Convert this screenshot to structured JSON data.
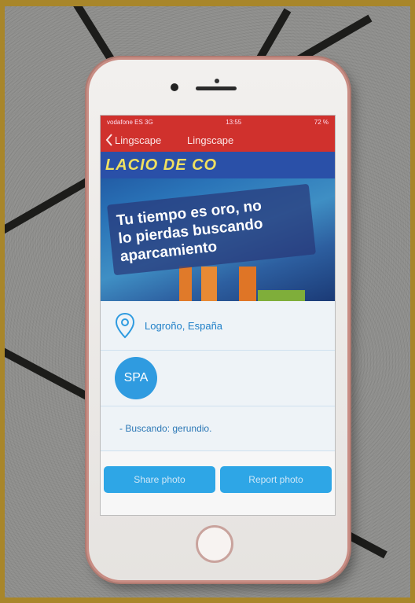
{
  "status_bar": {
    "carrier": "vodafone ES  3G",
    "time": "13:55",
    "battery": "72 %"
  },
  "navbar": {
    "back_label": "Lingscape",
    "title": "Lingscape"
  },
  "photo": {
    "top_text": "LACIO DE CO",
    "sign_lines": [
      "Tu tiempo es oro, no",
      "lo pierdas buscando",
      "aparcamiento"
    ]
  },
  "location": {
    "text": "Logroño, España",
    "icon": "location-pin-icon"
  },
  "language_badge": "SPA",
  "hint": "- Buscando: gerundio.",
  "buttons": {
    "share": "Share photo",
    "report": "Report photo"
  },
  "colors": {
    "accent_red": "#d0312d",
    "accent_blue": "#2ea6e6",
    "frame_gold": "#a8862a"
  }
}
